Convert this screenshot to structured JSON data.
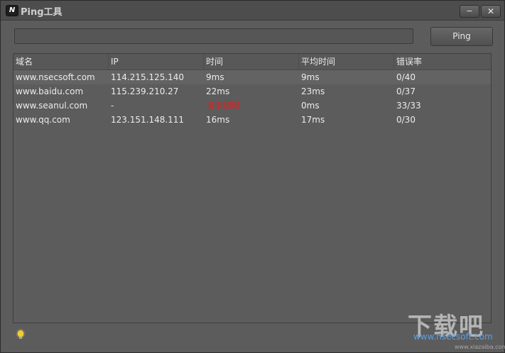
{
  "window": {
    "title": "Ping工具",
    "icon_text": "N",
    "minimize_label": "−",
    "close_label": "✕"
  },
  "ping": {
    "host_value": "",
    "button_label": "Ping"
  },
  "table": {
    "columns": [
      "域名",
      "IP",
      "时间",
      "平均时间",
      "错误率"
    ],
    "rows": [
      {
        "domain": "www.nsecsoft.com",
        "ip": "114.215.125.140",
        "time": "9ms",
        "avg": "9ms",
        "error": "0/40"
      },
      {
        "domain": "www.baidu.com",
        "ip": "115.239.210.27",
        "time": "22ms",
        "avg": "23ms",
        "error": "0/37"
      },
      {
        "domain": "www.seanul.com",
        "ip": "-",
        "time": "请求超时",
        "avg": "0ms",
        "error": "33/33"
      },
      {
        "domain": "www.qq.com",
        "ip": "123.151.148.111",
        "time": "16ms",
        "avg": "17ms",
        "error": "0/30"
      }
    ]
  },
  "footer": {
    "link": "www.nsecsoft.com",
    "watermark": "下载吧",
    "watermark_sub": "www.xiazaiba.com"
  },
  "colors": {
    "timeout": "#e02020",
    "link": "#5aa0e6"
  }
}
